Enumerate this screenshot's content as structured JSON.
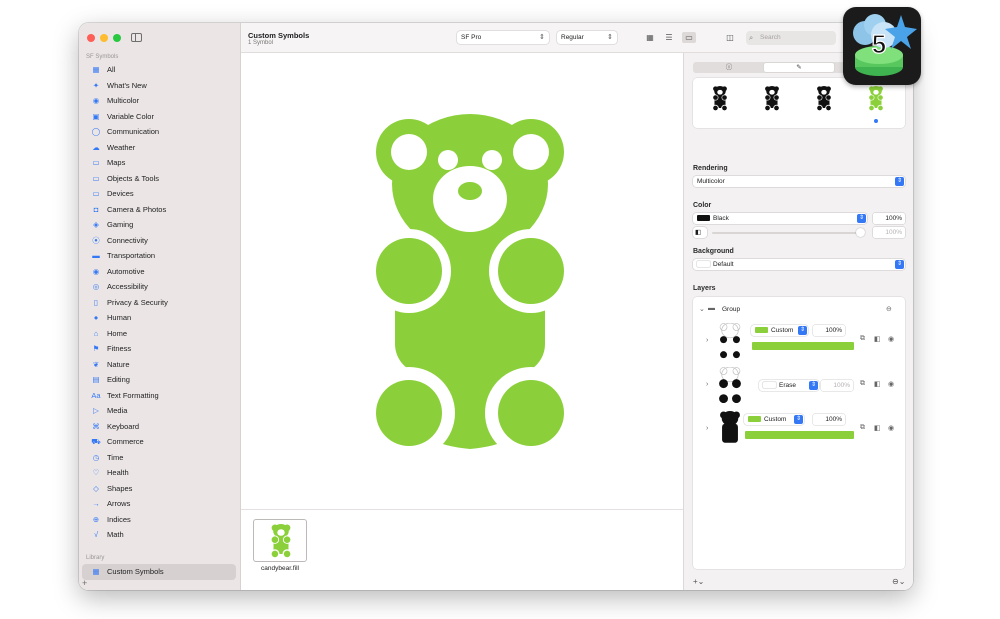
{
  "sidebar": {
    "section_title": "SF Symbols",
    "items": [
      {
        "label": "All",
        "icon": "grid-icon",
        "glyph": "▦"
      },
      {
        "label": "What's New",
        "icon": "sparkle-icon",
        "glyph": "✦"
      },
      {
        "label": "Multicolor",
        "icon": "paintpalette-icon",
        "glyph": "◉"
      },
      {
        "label": "Variable Color",
        "icon": "variable-color-icon",
        "glyph": "▣"
      },
      {
        "label": "Communication",
        "icon": "message-icon",
        "glyph": "◯"
      },
      {
        "label": "Weather",
        "icon": "cloud-icon",
        "glyph": "☁"
      },
      {
        "label": "Maps",
        "icon": "map-icon",
        "glyph": "▭"
      },
      {
        "label": "Objects & Tools",
        "icon": "folder-icon",
        "glyph": "▭"
      },
      {
        "label": "Devices",
        "icon": "desktop-icon",
        "glyph": "▭"
      },
      {
        "label": "Camera & Photos",
        "icon": "camera-icon",
        "glyph": "◘"
      },
      {
        "label": "Gaming",
        "icon": "gamecontroller-icon",
        "glyph": "◈"
      },
      {
        "label": "Connectivity",
        "icon": "antenna-icon",
        "glyph": "⦿"
      },
      {
        "label": "Transportation",
        "icon": "car-icon",
        "glyph": "▬"
      },
      {
        "label": "Automotive",
        "icon": "steering-wheel-icon",
        "glyph": "◉"
      },
      {
        "label": "Accessibility",
        "icon": "accessibility-icon",
        "glyph": "◎"
      },
      {
        "label": "Privacy & Security",
        "icon": "lock-icon",
        "glyph": "▯"
      },
      {
        "label": "Human",
        "icon": "person-icon",
        "glyph": "●"
      },
      {
        "label": "Home",
        "icon": "house-icon",
        "glyph": "⌂"
      },
      {
        "label": "Fitness",
        "icon": "figure-run-icon",
        "glyph": "⚑"
      },
      {
        "label": "Nature",
        "icon": "leaf-icon",
        "glyph": "❦"
      },
      {
        "label": "Editing",
        "icon": "pencil-icon",
        "glyph": "▤"
      },
      {
        "label": "Text Formatting",
        "icon": "textformat-icon",
        "glyph": "Aa"
      },
      {
        "label": "Media",
        "icon": "play-pause-icon",
        "glyph": "▷"
      },
      {
        "label": "Keyboard",
        "icon": "command-icon",
        "glyph": "⌘"
      },
      {
        "label": "Commerce",
        "icon": "cart-icon",
        "glyph": "⛟"
      },
      {
        "label": "Time",
        "icon": "clock-icon",
        "glyph": "◷"
      },
      {
        "label": "Health",
        "icon": "heart-icon",
        "glyph": "♡"
      },
      {
        "label": "Shapes",
        "icon": "shapes-icon",
        "glyph": "◇"
      },
      {
        "label": "Arrows",
        "icon": "arrow-right-icon",
        "glyph": "→"
      },
      {
        "label": "Indices",
        "icon": "indices-icon",
        "glyph": "⊕"
      },
      {
        "label": "Math",
        "icon": "function-icon",
        "glyph": "√"
      }
    ],
    "library_title": "Library",
    "library_item": {
      "label": "Custom Symbols",
      "glyph": "▦"
    }
  },
  "toolbar": {
    "title": "Custom Symbols",
    "subtitle": "1 Symbol",
    "font_popup": "SF Pro",
    "weight_popup": "Regular",
    "search_placeholder": "Search"
  },
  "gallery": {
    "symbol_name": "candybear.fill"
  },
  "inspector": {
    "rendering_label": "Rendering",
    "rendering_value": "Multicolor",
    "color_label": "Color",
    "color_value": "Black",
    "color_pct": "100%",
    "color_pct2": "100%",
    "background_label": "Background",
    "background_value": "Default",
    "layers_label": "Layers",
    "group_label": "Group",
    "layers": [
      {
        "mode": "Custom",
        "pct": "100%"
      },
      {
        "mode": "Erase",
        "pct": "100%"
      },
      {
        "mode": "Custom",
        "pct": "100%"
      }
    ]
  },
  "colors": {
    "accent": "#3478f6",
    "bear_green": "#8bd03a"
  }
}
